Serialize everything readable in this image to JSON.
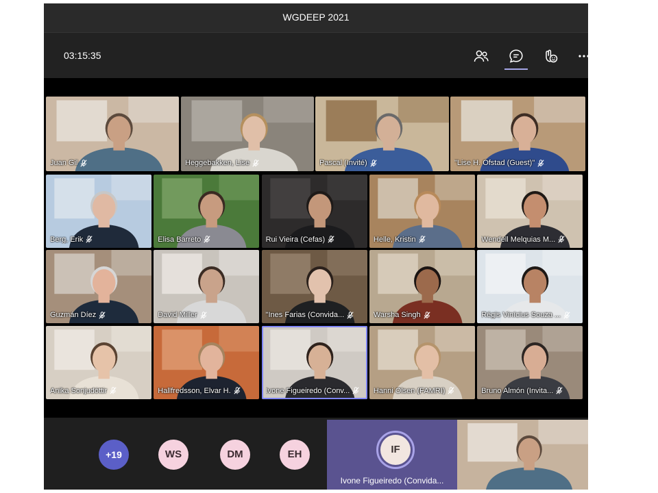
{
  "window": {
    "title": "WGDEEP 2021"
  },
  "toolbar": {
    "timer": "03:15:35",
    "icons": [
      "people-icon",
      "chat-icon",
      "reactions-icon",
      "more-icon"
    ],
    "active_color": "#a6a7e8"
  },
  "participants": [
    {
      "name": "Juan Gil",
      "bg": "#cbb8a4",
      "wall": "#e9e5df",
      "skin": "#c9a084",
      "shirt": "#4f6f86",
      "hair": "#5c4a3d"
    },
    {
      "name": "Heggebakken, Lise",
      "bg": "#8a847b",
      "wall": "#b6b1aa",
      "skin": "#e0bfa8",
      "shirt": "#d9d6cf",
      "hair": "#b5905e"
    },
    {
      "name": "Pascal (Invité)",
      "bg": "#c9b79a",
      "wall": "#8b6a43",
      "skin": "#d3b097",
      "shirt": "#3b5d9a",
      "hair": "#6a6a6a"
    },
    {
      "name": "\"Lise H. Ofstad (Guest)\"",
      "bg": "#b89a78",
      "wall": "#e5e1da",
      "skin": "#d8b097",
      "shirt": "#2f4b8c",
      "hair": "#3d2d24"
    },
    {
      "name": "Berg, Erik",
      "bg": "#b7cbe0",
      "wall": "#dfe7ee",
      "skin": "#e0b9a3",
      "shirt": "#1f2a3a",
      "hair": "#c7c7c7"
    },
    {
      "name": "Elisa Barreto",
      "bg": "#4b7a3a",
      "wall": "#7fa66a",
      "skin": "#c79b7f",
      "shirt": "#8a8a92",
      "hair": "#3a2a22"
    },
    {
      "name": "Rui Vieira (Cefas)",
      "bg": "#2d2b2b",
      "wall": "#4a4747",
      "skin": "#c3977a",
      "shirt": "#1b1b1d",
      "hair": "#1e1a18"
    },
    {
      "name": "Helle, Kristin",
      "bg": "#a8845e",
      "wall": "#d9d2c4",
      "skin": "#e0b99f",
      "shirt": "#5b6e8a",
      "hair": "#b88a5a"
    },
    {
      "name": "Wendell Melquias M...",
      "bg": "#cfc2b0",
      "wall": "#e9e1d6",
      "skin": "#c48e6f",
      "shirt": "#2d2d33",
      "hair": "#1f1915"
    },
    {
      "name": "Guzmán Díez",
      "bg": "#a58f7b",
      "wall": "#d8d2ca",
      "skin": "#e3b39b",
      "shirt": "#1e2b3c",
      "hair": "#d6d6d6"
    },
    {
      "name": "David Miller",
      "bg": "#c9c4bd",
      "wall": "#eeeae6",
      "skin": "#c9a38b",
      "shirt": "#d8d8d8",
      "hair": "#3b2c24"
    },
    {
      "name": "\"Ines Farias (Convida...",
      "bg": "#6e5a45",
      "wall": "#9b8772",
      "skin": "#e2c2ad",
      "shirt": "#1e2022",
      "hair": "#2a201b"
    },
    {
      "name": "Warsha Singh",
      "bg": "#b8a890",
      "wall": "#e0d6c6",
      "skin": "#9c6a4c",
      "shirt": "#7a2f22",
      "hair": "#1b1412"
    },
    {
      "name": "Régis Vinícius Souza ...",
      "bg": "#dde4ea",
      "wall": "#f2f4f6",
      "skin": "#b88364",
      "shirt": "#e6e8ea",
      "hair": "#1d1815"
    },
    {
      "name": "Anika Sonjudóttir",
      "bg": "#d7cfc4",
      "wall": "#f0ebe5",
      "skin": "#e6c3a9",
      "shirt": "#e8e1d6",
      "hair": "#5a4332"
    },
    {
      "name": "Hallfredsson, Elvar H.",
      "bg": "#c76a3a",
      "wall": "#e0a078",
      "skin": "#e2b49c",
      "shirt": "#1d2330",
      "hair": "#a6845f"
    },
    {
      "name": "Ivone Figueiredo (Conv...",
      "bg": "#cfcac4",
      "wall": "#ebe7e2",
      "skin": "#d7b196",
      "shirt": "#2a2a2e",
      "hair": "#2e221c"
    },
    {
      "name": "Hanni Olsen (FAMRI)",
      "bg": "#b59f84",
      "wall": "#e6dccf",
      "skin": "#e3bfa6",
      "shirt": "#d8d0c4",
      "hair": "#b5946c"
    },
    {
      "name": "Bruno Almón (Invita...",
      "bg": "#9a8a7a",
      "wall": "#c9bfb3",
      "skin": "#d8ad94",
      "shirt": "#3a3c42",
      "hair": "#2c2522"
    }
  ],
  "bottom_bar": {
    "overflow": "+19",
    "avatars": [
      {
        "initials": "WS"
      },
      {
        "initials": "DM"
      },
      {
        "initials": "EH"
      }
    ],
    "spotlight": {
      "initials": "IF",
      "name": "Ivone Figueiredo (Convida..."
    },
    "self_view": {
      "bg": "#c6b39e",
      "wall": "#ece7e0",
      "skin": "#c9a084",
      "shirt": "#4f6f86",
      "hair": "#5c4a3d"
    }
  }
}
